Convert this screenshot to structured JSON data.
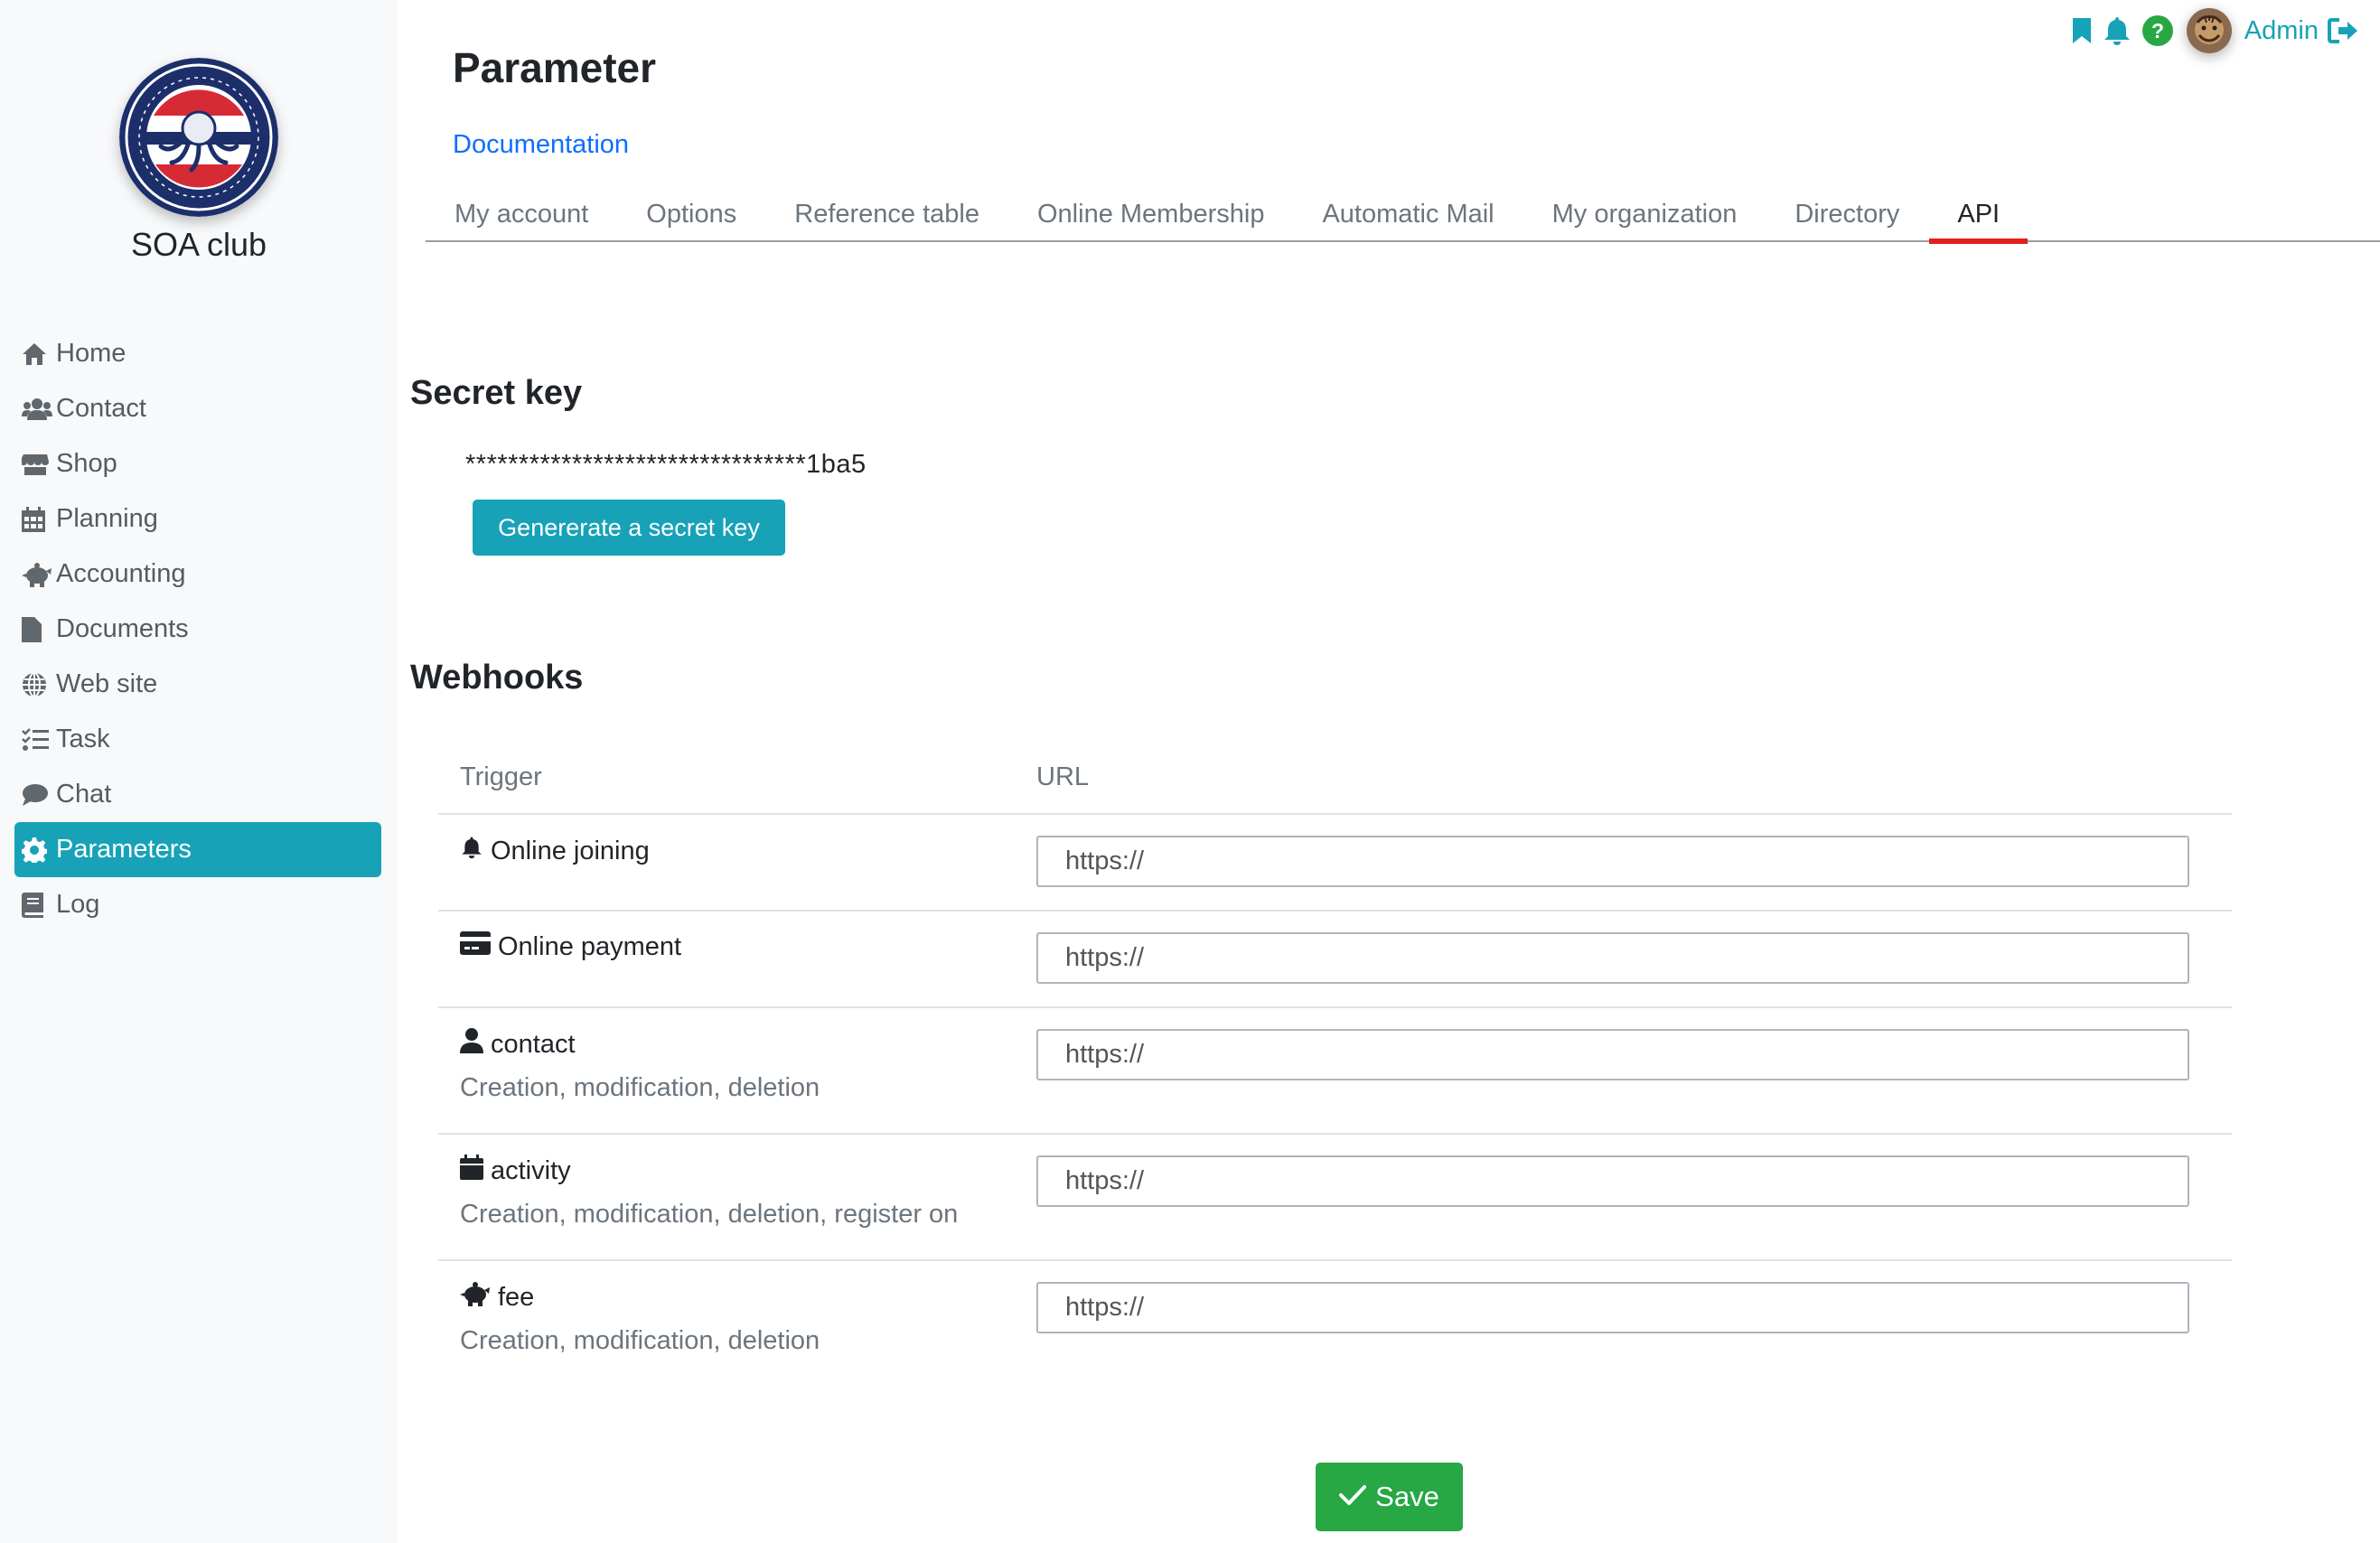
{
  "app": {
    "club_name": "SOA club"
  },
  "sidebar": {
    "items": [
      {
        "label": "Home",
        "icon": "home-icon"
      },
      {
        "label": "Contact",
        "icon": "users-icon"
      },
      {
        "label": "Shop",
        "icon": "store-icon"
      },
      {
        "label": "Planning",
        "icon": "calendar-icon"
      },
      {
        "label": "Accounting",
        "icon": "piggy-bank-icon"
      },
      {
        "label": "Documents",
        "icon": "file-icon"
      },
      {
        "label": "Web site",
        "icon": "globe-icon"
      },
      {
        "label": "Task",
        "icon": "tasks-icon"
      },
      {
        "label": "Chat",
        "icon": "comment-icon"
      },
      {
        "label": "Parameters",
        "icon": "gear-icon",
        "active": true
      },
      {
        "label": "Log",
        "icon": "book-icon"
      }
    ]
  },
  "topbar": {
    "user": "Admin"
  },
  "header": {
    "title": "Parameter",
    "doc_link": "Documentation",
    "tabs": [
      {
        "label": "My account"
      },
      {
        "label": "Options"
      },
      {
        "label": "Reference table"
      },
      {
        "label": "Online Membership"
      },
      {
        "label": "Automatic Mail"
      },
      {
        "label": "My organization"
      },
      {
        "label": "Directory"
      },
      {
        "label": "API",
        "active": true
      }
    ]
  },
  "secret": {
    "title": "Secret key",
    "value": "********************************1ba5",
    "generate_label": "Genererate a secret key"
  },
  "webhooks": {
    "title": "Webhooks",
    "col_trigger": "Trigger",
    "col_url": "URL",
    "rows": [
      {
        "name": "Online joining",
        "desc": "",
        "icon": "bell-icon",
        "placeholder": "https://"
      },
      {
        "name": "Online payment",
        "desc": "",
        "icon": "credit-card-icon",
        "placeholder": "https://"
      },
      {
        "name": "contact",
        "desc": "Creation, modification, deletion",
        "icon": "user-icon",
        "placeholder": "https://"
      },
      {
        "name": "activity",
        "desc": "Creation, modification, deletion, register on",
        "icon": "calendar-icon",
        "placeholder": "https://"
      },
      {
        "name": "fee",
        "desc": "Creation, modification, deletion",
        "icon": "piggy-bank-icon",
        "placeholder": "https://"
      }
    ]
  },
  "actions": {
    "save_label": "Save"
  },
  "colors": {
    "accent": "#17a2b8",
    "save": "#28a745",
    "active_tab": "#e0201c",
    "link": "#0d6efd"
  }
}
